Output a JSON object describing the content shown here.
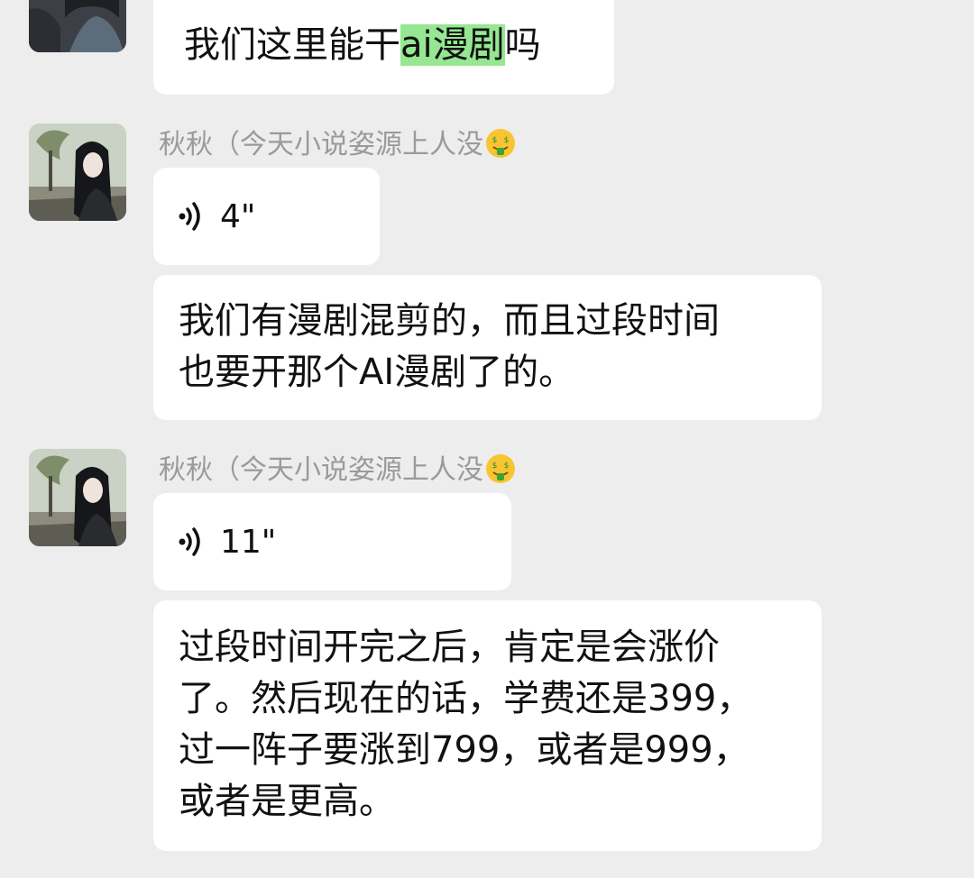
{
  "messages": [
    {
      "type": "text",
      "text_before": "我们这里能干",
      "highlight": "ai漫剧",
      "text_after": "吗"
    },
    {
      "type": "sender",
      "name": "秋秋（今天小说姿源上人没",
      "emoji": "money-mouth-face-icon"
    },
    {
      "type": "voice",
      "duration": "4\""
    },
    {
      "type": "text",
      "lines": [
        "我们有漫剧混剪的，而且过段时间",
        "也要开那个AI漫剧了的。"
      ]
    },
    {
      "type": "sender",
      "name": "秋秋（今天小说姿源上人没",
      "emoji": "money-mouth-face-icon"
    },
    {
      "type": "voice",
      "duration": "11\""
    },
    {
      "type": "text",
      "lines": [
        "过段时间开完之后，肯定是会涨价",
        "了。然后现在的话，学费还是399，",
        "过一阵子要涨到799，或者是999，",
        "或者是更高。"
      ]
    }
  ],
  "colors": {
    "background": "#ededed",
    "bubble": "#ffffff",
    "highlight": "#95e792",
    "sender_name": "#9a9a9a"
  }
}
